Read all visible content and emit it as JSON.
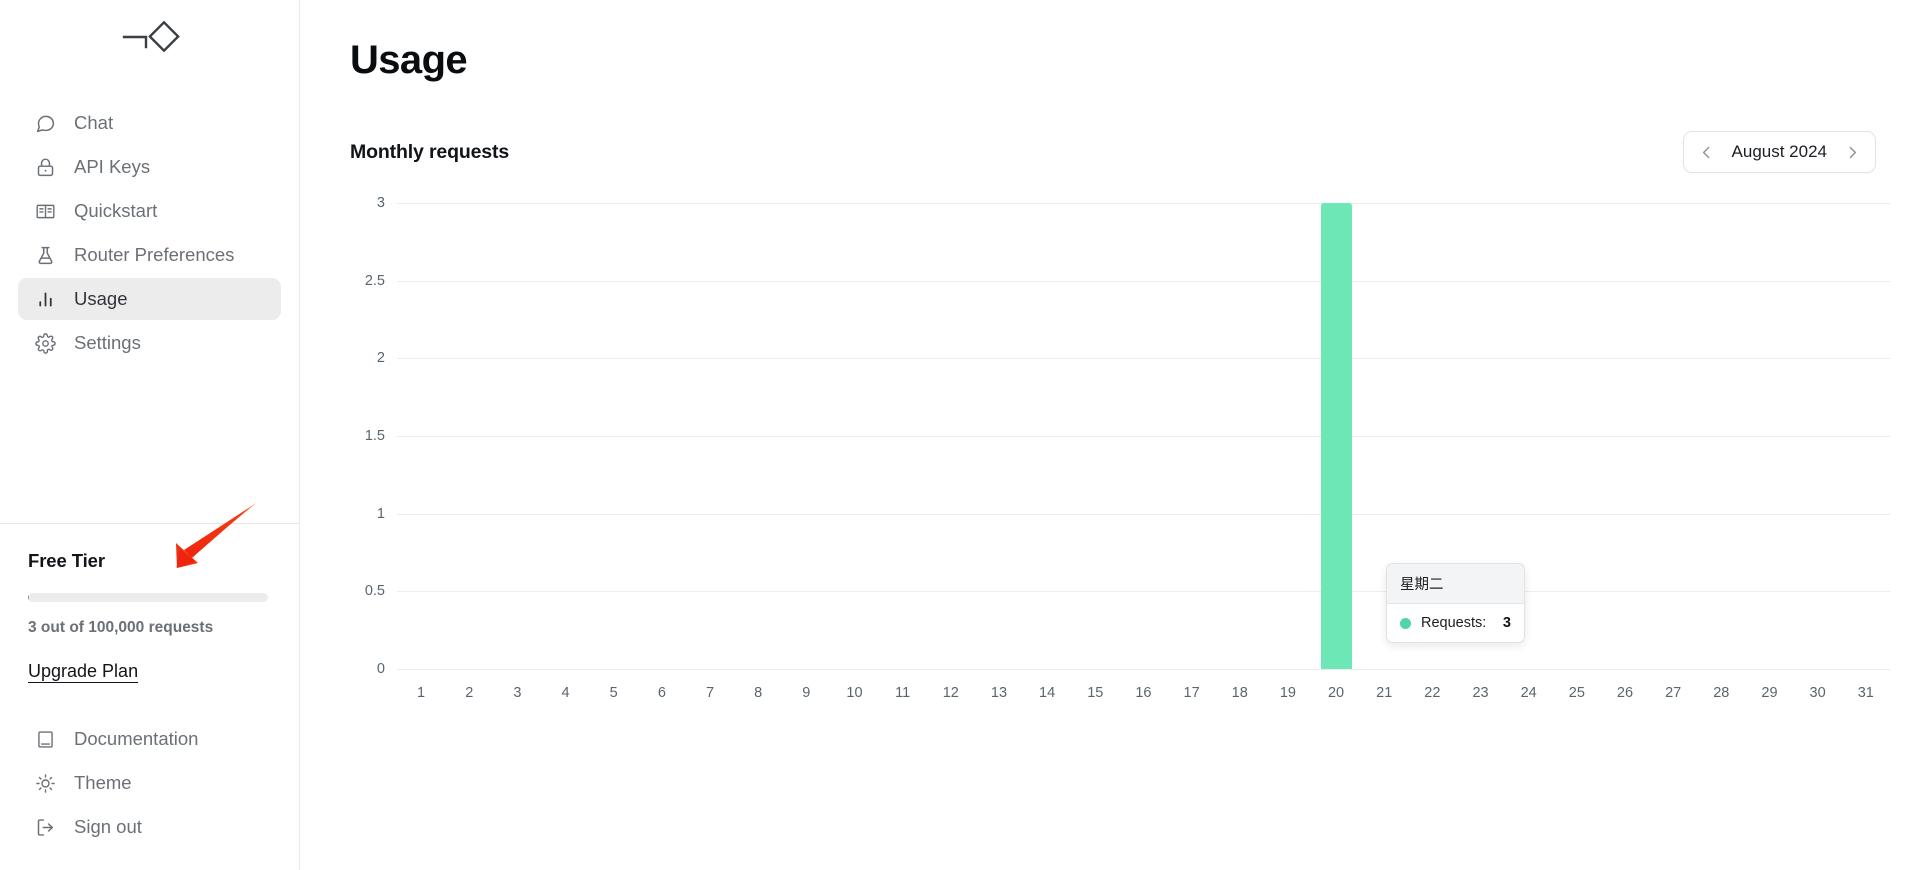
{
  "brand": {
    "logo_icon": "line-diamond-logo"
  },
  "sidebar": {
    "items": [
      {
        "label": "Chat",
        "icon": "message-circle-icon",
        "active": false
      },
      {
        "label": "API Keys",
        "icon": "lock-icon",
        "active": false
      },
      {
        "label": "Quickstart",
        "icon": "book-open-icon",
        "active": false
      },
      {
        "label": "Router Preferences",
        "icon": "flask-icon",
        "active": false
      },
      {
        "label": "Usage",
        "icon": "bar-chart-icon",
        "active": true
      },
      {
        "label": "Settings",
        "icon": "gear-icon",
        "active": false
      }
    ],
    "plan": {
      "title": "Free Tier",
      "usage_text": "3 out of 100,000 requests",
      "used": 3,
      "limit": 100000,
      "upgrade_label": "Upgrade Plan"
    },
    "footer_items": [
      {
        "label": "Documentation",
        "icon": "book-icon"
      },
      {
        "label": "Theme",
        "icon": "sun-icon"
      },
      {
        "label": "Sign out",
        "icon": "logout-icon"
      }
    ]
  },
  "main": {
    "page_title": "Usage",
    "chart_subtitle": "Monthly requests",
    "month_nav": {
      "prev_icon": "chevron-left-icon",
      "next_icon": "chevron-right-icon",
      "current": "August 2024"
    },
    "tooltip": {
      "title": "星期二",
      "series_label": "Requests:",
      "value": "3",
      "dot_color": "#4fd6a4"
    }
  },
  "annotation": {
    "arrow_color": "#f22c12",
    "arrow_icon": "red-pointer-arrow"
  },
  "colors": {
    "bar": "#6EE7B7",
    "grid": "#ededed",
    "sidebar_active": "#ececec",
    "text_muted": "#6b7077"
  },
  "chart_data": {
    "type": "bar",
    "title": "Monthly requests",
    "xlabel": "",
    "ylabel": "",
    "ylim": [
      0,
      3
    ],
    "yticks": [
      3,
      2.5,
      2,
      1.5,
      1,
      0.5,
      0
    ],
    "grid": true,
    "legend": false,
    "series_name": "Requests",
    "bar_color": "#6EE7B7",
    "categories": [
      "1",
      "2",
      "3",
      "4",
      "5",
      "6",
      "7",
      "8",
      "9",
      "10",
      "11",
      "12",
      "13",
      "14",
      "15",
      "16",
      "17",
      "18",
      "19",
      "20",
      "21",
      "22",
      "23",
      "24",
      "25",
      "26",
      "27",
      "28",
      "29",
      "30",
      "31"
    ],
    "values": [
      0,
      0,
      0,
      0,
      0,
      0,
      0,
      0,
      0,
      0,
      0,
      0,
      0,
      0,
      0,
      0,
      0,
      0,
      0,
      3,
      0,
      0,
      0,
      0,
      0,
      0,
      0,
      0,
      0,
      0,
      0
    ],
    "annotations": [
      {
        "x": "20",
        "weekday": "星期二",
        "label": "Requests:",
        "value": 3
      }
    ]
  }
}
